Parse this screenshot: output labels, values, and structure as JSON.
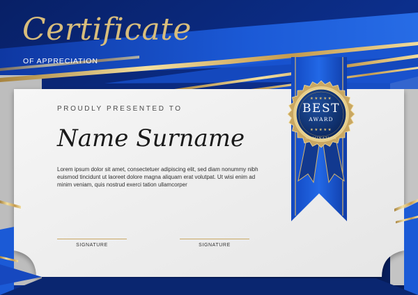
{
  "certificate": {
    "title": "Certificate",
    "subtitle": "OF APPRECIATION",
    "presented_label": "PROUDLY PRESENTED TO",
    "recipient_name": "Name Surname",
    "body_text": "Lorem ipsum dolor sit amet, consectetuer adipiscing elit, sed diam nonummy nibh euismod tincidunt ut laoreet dolore magna aliquam erat volutpat. Ut wisi enim ad minim veniam, quis nostrud exerci tation ullamcorper",
    "signatures": [
      {
        "label": "SIGNATURE"
      },
      {
        "label": "SIGNATURE"
      }
    ]
  },
  "badge": {
    "headline": "BEST",
    "subline": "AWARD",
    "caption": "NOMINATION",
    "stars": "★★★★★",
    "icon": "award-medal-icon"
  },
  "colors": {
    "navy": "#0a2a7a",
    "royal_blue": "#1f63e0",
    "gold": "#c9a762",
    "light_gold": "#f1dc9c",
    "paper": "#f2f2f2",
    "ribbon": "#1d5fd8"
  }
}
